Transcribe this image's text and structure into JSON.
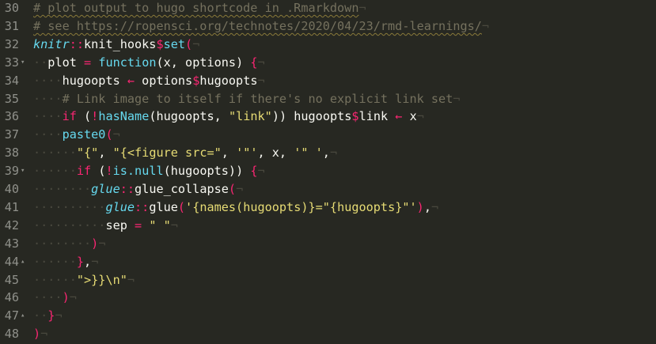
{
  "editor": {
    "lines": [
      {
        "num": "30",
        "fold": "",
        "tokens": [
          {
            "t": "# plot output to hugo shortcode in .Rmarkdown",
            "c": "url"
          },
          {
            "t": "¬",
            "c": "inv"
          }
        ]
      },
      {
        "num": "31",
        "fold": "",
        "tokens": [
          {
            "t": "# see https://ropensci.org/technotes/2020/04/23/rmd-learnings/",
            "c": "url"
          },
          {
            "t": "¬",
            "c": "inv"
          }
        ]
      },
      {
        "num": "32",
        "fold": "",
        "tokens": [
          {
            "t": "knitr",
            "c": "ns"
          },
          {
            "t": "::",
            "c": "op"
          },
          {
            "t": "knit_hooks",
            "c": "id"
          },
          {
            "t": "$",
            "c": "op"
          },
          {
            "t": "set",
            "c": "fn"
          },
          {
            "t": "(",
            "c": "op"
          },
          {
            "t": "¬",
            "c": "inv"
          }
        ]
      },
      {
        "num": "33",
        "fold": "▾",
        "tokens": [
          {
            "t": "··",
            "c": "inv"
          },
          {
            "t": "plot ",
            "c": "id"
          },
          {
            "t": "=",
            "c": "op"
          },
          {
            "t": " ",
            "c": "id"
          },
          {
            "t": "function",
            "c": "fn"
          },
          {
            "t": "(x, options) ",
            "c": "id"
          },
          {
            "t": "{",
            "c": "op"
          },
          {
            "t": "¬",
            "c": "inv"
          }
        ]
      },
      {
        "num": "34",
        "fold": "",
        "tokens": [
          {
            "t": "····",
            "c": "inv"
          },
          {
            "t": "hugoopts ",
            "c": "id"
          },
          {
            "t": "←",
            "c": "op"
          },
          {
            "t": " options",
            "c": "id"
          },
          {
            "t": "$",
            "c": "op"
          },
          {
            "t": "hugoopts",
            "c": "id"
          },
          {
            "t": "¬",
            "c": "inv"
          }
        ]
      },
      {
        "num": "35",
        "fold": "",
        "tokens": [
          {
            "t": "····",
            "c": "inv"
          },
          {
            "t": "# Link image to itself if there's no explicit link set",
            "c": "comment"
          },
          {
            "t": "¬",
            "c": "inv"
          }
        ]
      },
      {
        "num": "36",
        "fold": "",
        "tokens": [
          {
            "t": "····",
            "c": "inv"
          },
          {
            "t": "if",
            "c": "kw"
          },
          {
            "t": " (",
            "c": "id"
          },
          {
            "t": "!",
            "c": "op"
          },
          {
            "t": "hasName",
            "c": "fn"
          },
          {
            "t": "(hugoopts, ",
            "c": "id"
          },
          {
            "t": "\"link\"",
            "c": "str"
          },
          {
            "t": ")) hugoopts",
            "c": "id"
          },
          {
            "t": "$",
            "c": "op"
          },
          {
            "t": "link ",
            "c": "id"
          },
          {
            "t": "←",
            "c": "op"
          },
          {
            "t": " x",
            "c": "id"
          },
          {
            "t": "¬",
            "c": "inv"
          }
        ]
      },
      {
        "num": "37",
        "fold": "",
        "tokens": [
          {
            "t": "····",
            "c": "inv"
          },
          {
            "t": "paste0",
            "c": "fn"
          },
          {
            "t": "(",
            "c": "op"
          },
          {
            "t": "¬",
            "c": "inv"
          }
        ]
      },
      {
        "num": "38",
        "fold": "",
        "tokens": [
          {
            "t": "······",
            "c": "inv"
          },
          {
            "t": "\"{\"",
            "c": "str"
          },
          {
            "t": ", ",
            "c": "id"
          },
          {
            "t": "\"{<figure src=\"",
            "c": "str"
          },
          {
            "t": ", ",
            "c": "id"
          },
          {
            "t": "'\"'",
            "c": "str"
          },
          {
            "t": ", x, ",
            "c": "id"
          },
          {
            "t": "'\" '",
            "c": "str"
          },
          {
            "t": ",",
            "c": "id"
          },
          {
            "t": "¬",
            "c": "inv"
          }
        ]
      },
      {
        "num": "39",
        "fold": "▾",
        "tokens": [
          {
            "t": "······",
            "c": "inv"
          },
          {
            "t": "if",
            "c": "kw"
          },
          {
            "t": " (",
            "c": "id"
          },
          {
            "t": "!",
            "c": "op"
          },
          {
            "t": "is.null",
            "c": "fn"
          },
          {
            "t": "(hugoopts)) ",
            "c": "id"
          },
          {
            "t": "{",
            "c": "op"
          },
          {
            "t": "¬",
            "c": "inv"
          }
        ]
      },
      {
        "num": "40",
        "fold": "",
        "tokens": [
          {
            "t": "········",
            "c": "inv"
          },
          {
            "t": "glue",
            "c": "ns"
          },
          {
            "t": "::",
            "c": "op"
          },
          {
            "t": "glue_collapse",
            "c": "id"
          },
          {
            "t": "(",
            "c": "op"
          },
          {
            "t": "¬",
            "c": "inv"
          }
        ]
      },
      {
        "num": "41",
        "fold": "",
        "tokens": [
          {
            "t": "··········",
            "c": "inv"
          },
          {
            "t": "glue",
            "c": "ns"
          },
          {
            "t": "::",
            "c": "op"
          },
          {
            "t": "glue",
            "c": "id"
          },
          {
            "t": "(",
            "c": "op"
          },
          {
            "t": "'{names(hugoopts)}=\"{hugoopts}\"'",
            "c": "str"
          },
          {
            "t": ")",
            "c": "op"
          },
          {
            "t": ",",
            "c": "id"
          },
          {
            "t": "¬",
            "c": "inv"
          }
        ]
      },
      {
        "num": "42",
        "fold": "",
        "tokens": [
          {
            "t": "··········",
            "c": "inv"
          },
          {
            "t": "sep ",
            "c": "id"
          },
          {
            "t": "=",
            "c": "op"
          },
          {
            "t": " ",
            "c": "id"
          },
          {
            "t": "\" \"",
            "c": "str"
          },
          {
            "t": "¬",
            "c": "inv"
          }
        ]
      },
      {
        "num": "43",
        "fold": "",
        "tokens": [
          {
            "t": "········",
            "c": "inv"
          },
          {
            "t": ")",
            "c": "op"
          },
          {
            "t": "¬",
            "c": "inv"
          }
        ]
      },
      {
        "num": "44",
        "fold": "▴",
        "tokens": [
          {
            "t": "······",
            "c": "inv"
          },
          {
            "t": "}",
            "c": "op"
          },
          {
            "t": ",",
            "c": "id"
          },
          {
            "t": "¬",
            "c": "inv"
          }
        ]
      },
      {
        "num": "45",
        "fold": "",
        "tokens": [
          {
            "t": "······",
            "c": "inv"
          },
          {
            "t": "\">}}\\n\"",
            "c": "str"
          },
          {
            "t": "¬",
            "c": "inv"
          }
        ]
      },
      {
        "num": "46",
        "fold": "",
        "tokens": [
          {
            "t": "····",
            "c": "inv"
          },
          {
            "t": ")",
            "c": "op"
          },
          {
            "t": "¬",
            "c": "inv"
          }
        ]
      },
      {
        "num": "47",
        "fold": "▴",
        "tokens": [
          {
            "t": "··",
            "c": "inv"
          },
          {
            "t": "}",
            "c": "op"
          },
          {
            "t": "¬",
            "c": "inv"
          }
        ]
      },
      {
        "num": "48",
        "fold": "",
        "tokens": [
          {
            "t": ")",
            "c": "op"
          },
          {
            "t": "¬",
            "c": "inv"
          }
        ]
      }
    ]
  }
}
